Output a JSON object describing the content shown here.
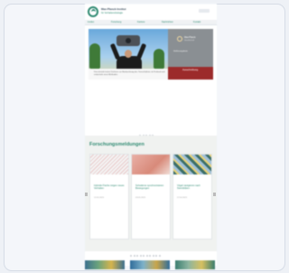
{
  "header": {
    "org_name": "Max-Planck-Institut",
    "org_sub": "für Verhaltensbiologie",
    "lang_label": "EN"
  },
  "nav": {
    "items": [
      "Institut",
      "Forschung",
      "Karriere",
      "Nachrichten",
      "Kontakt"
    ]
  },
  "hero": {
    "side_org": "Max-Planck",
    "side_sub": "Gesellschaft",
    "side_caption": "Stellenangebote",
    "cta_label": "Ausschreibung",
    "text": "Forschende testen Drohnen zur Beobachtung des Tierverhaltens im Freiland und entwickeln neue Methoden."
  },
  "section": {
    "title": "Forschungsmeldungen",
    "news": [
      {
        "title": "Hybride Fische zeigen neues Verhalten",
        "date": "12.05.2023"
      },
      {
        "title": "Schwärme synchronisieren Bewegungen",
        "date": "03.05.2023"
      },
      {
        "title": "Vögel navigieren nach Sternbildern",
        "date": "27.04.2023"
      }
    ]
  },
  "colors": {
    "accent": "#2f8a72",
    "cta": "#9c2b2b",
    "side_panel": "#8a8f93"
  }
}
